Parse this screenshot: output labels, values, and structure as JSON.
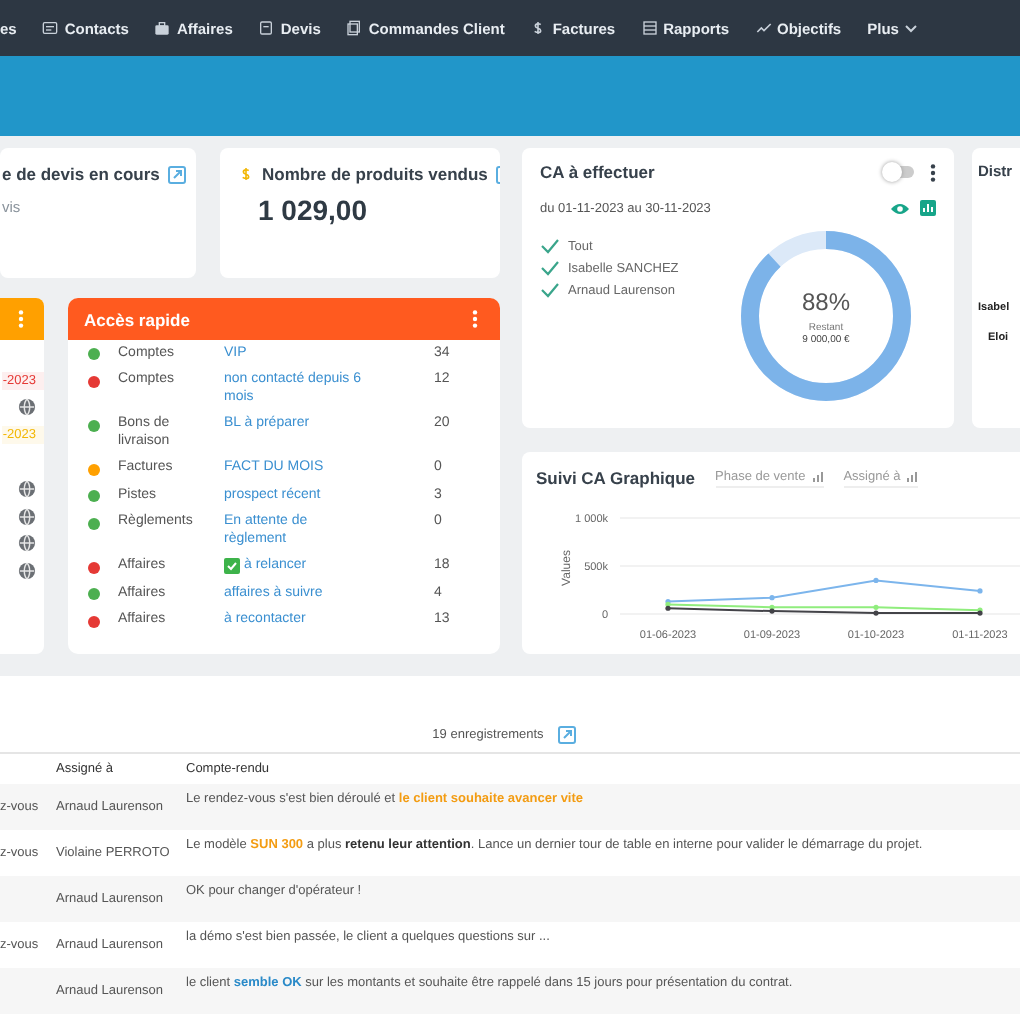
{
  "nav": [
    {
      "label": "es"
    },
    {
      "label": "Contacts"
    },
    {
      "label": "Affaires"
    },
    {
      "label": "Devis"
    },
    {
      "label": "Commandes Client"
    },
    {
      "label": "Factures"
    },
    {
      "label": "Rapports"
    },
    {
      "label": "Objectifs"
    },
    {
      "label": "Plus",
      "caret": true
    }
  ],
  "kpi_cards": [
    {
      "title": "e de devis en cours",
      "subtitle": "vis"
    },
    {
      "title": "Nombre de produits vendus",
      "value": "1 029,00"
    }
  ],
  "left_card": {
    "rows": [
      {
        "kind": "blank"
      },
      {
        "kind": "date",
        "text": "-2023",
        "color": "#e53935"
      },
      {
        "kind": "globe"
      },
      {
        "kind": "date",
        "text": "-2023",
        "color": "#f2b705"
      },
      {
        "kind": "blank"
      },
      {
        "kind": "globe"
      },
      {
        "kind": "globe"
      },
      {
        "kind": "globe"
      },
      {
        "kind": "globe"
      }
    ]
  },
  "quick_access": {
    "title": "Accès rapide",
    "rows": [
      {
        "color": "#4caf50",
        "category": "Comptes",
        "link": "VIP",
        "count": "34"
      },
      {
        "color": "#e53935",
        "category": "Comptes",
        "link": "non contacté depuis 6 mois",
        "count": "12"
      },
      {
        "color": "#4caf50",
        "category": "Bons de livraison",
        "link": "BL à préparer",
        "count": "20"
      },
      {
        "color": "#ffa000",
        "category": "Factures",
        "link": "FACT DU MOIS",
        "count": "0"
      },
      {
        "color": "#4caf50",
        "category": "Pistes",
        "link": "prospect récent",
        "count": "3"
      },
      {
        "color": "#4caf50",
        "category": "Règlements",
        "link": "En attente de règlement",
        "count": "0"
      },
      {
        "color": "#e53935",
        "category": "Affaires",
        "link": "à relancer",
        "count": "18"
      },
      {
        "color": "#4caf50",
        "category": "Affaires",
        "link": "affaires à suivre",
        "count": "4"
      },
      {
        "color": "#e53935",
        "category": "Affaires",
        "link": "à recontacter",
        "count": "13"
      }
    ]
  },
  "ca_card": {
    "title": "CA à effectuer",
    "toggle_on": false,
    "period": "du 01-11-2023 au 30-11-2023",
    "filters": [
      "Tout",
      "Isabelle SANCHEZ",
      "Arnaud Laurenson"
    ],
    "level": 0.88,
    "percent": "88%",
    "remaining_label": "Restant",
    "remaining": "9 000,00 €"
  },
  "distribution_card": {
    "title": "Distr",
    "names": [
      "Isabel",
      "Eloi"
    ]
  },
  "chart_card": {
    "title": "Suivi CA Graphique",
    "filters": [
      "Phase de vente",
      "Assigné à"
    ],
    "chart_data": {
      "type": "line",
      "ylabel": "Values",
      "categories": [
        "01-06-2023",
        "01-09-2023",
        "01-10-2023",
        "01-11-2023"
      ],
      "ylim": [
        0,
        1000000
      ],
      "yticks": [
        {
          "value": 0,
          "label": "0"
        },
        {
          "value": 500000,
          "label": "500k"
        },
        {
          "value": 1000000,
          "label": "1 000k"
        }
      ],
      "series": [
        {
          "color": "#7cb5ec",
          "marker": true,
          "values": [
            130000,
            170000,
            350000,
            240000
          ]
        },
        {
          "color": "#90ed7d",
          "marker": true,
          "values": [
            100000,
            70000,
            70000,
            40000
          ]
        },
        {
          "color": "#434348",
          "marker": true,
          "values": [
            60000,
            30000,
            10000,
            10000
          ]
        }
      ]
    }
  },
  "records": {
    "count": "19 enregistrements",
    "columns": [
      "",
      "Assigné à",
      "Compte-rendu"
    ],
    "rows": [
      {
        "type": "z-vous",
        "assignee": "Arnaud Laurenson",
        "report": [
          {
            "text": "Le rendez-vous s'est bien déroulé et "
          },
          {
            "text": "le client souhaite avancer vite",
            "kind": "highlight"
          }
        ]
      },
      {
        "type": "z-vous",
        "assignee": "Violaine PERROTO",
        "report": [
          {
            "text": "Le modèle "
          },
          {
            "text": "SUN 300",
            "kind": "highlight"
          },
          {
            "text": " a plus "
          },
          {
            "text": "retenu leur attention",
            "kind": "strong"
          },
          {
            "text": ". Lance un dernier tour de table en interne pour valider le démarrage du projet."
          }
        ]
      },
      {
        "assignee": "Arnaud Laurenson",
        "report": [
          {
            "text": "OK pour changer d'opérateur !"
          }
        ]
      },
      {
        "type": "z-vous",
        "assignee": "Arnaud Laurenson",
        "report": [
          {
            "text": "la démo s'est bien passée, le client a quelques questions sur ..."
          }
        ]
      },
      {
        "assignee": "Arnaud Laurenson",
        "report": [
          {
            "text": "le client "
          },
          {
            "text": "semble OK",
            "kind": "keyword"
          },
          {
            "text": " sur les montants et souhaite être rappelé dans 15 jours pour présentation du contrat."
          }
        ]
      }
    ]
  }
}
